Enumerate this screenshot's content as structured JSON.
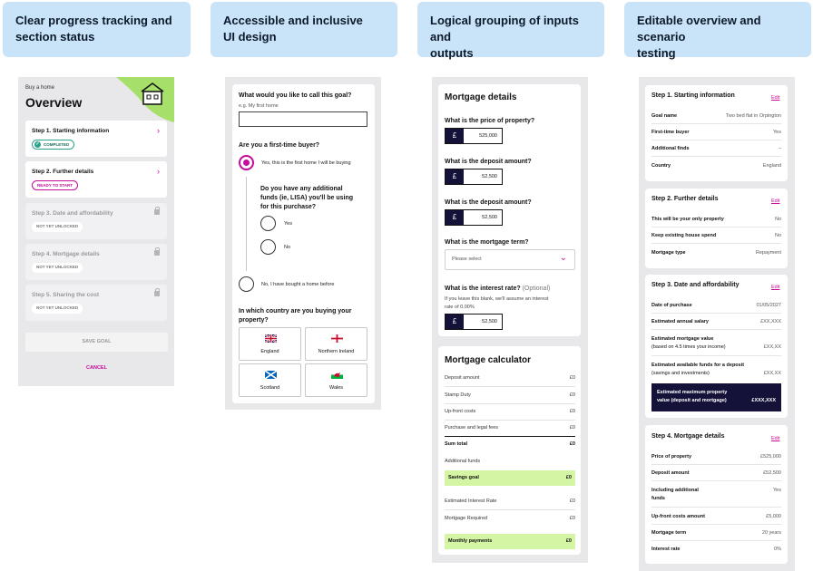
{
  "headers": [
    {
      "line1": "Clear progress tracking and",
      "line2": "section status"
    },
    {
      "line1": "Accessible and inclusive",
      "line2": "UI design"
    },
    {
      "line1": "Logical grouping of inputs and",
      "line2": "outputs"
    },
    {
      "line1": "Editable overview and scenario",
      "line2": "testing"
    }
  ],
  "overview": {
    "eyebrow": "Buy a home",
    "title": "Overview",
    "steps": [
      {
        "title": "Step 1. Starting information",
        "status": "COMPLETED"
      },
      {
        "title": "Step 2. Further details",
        "status": "READY TO START"
      },
      {
        "title": "Step 3. Date and affordability",
        "status": "NOT YET UNLOCKED"
      },
      {
        "title": "Step 4. Mortgage details",
        "status": "NOT YET UNLOCKED"
      },
      {
        "title": "Step 5. Sharing the cost",
        "status": "NOT YET UNLOCKED"
      }
    ],
    "save_label": "SAVE GOAL",
    "cancel_label": "CANCEL",
    "accent": "#c60a9a"
  },
  "form": {
    "goal_question": "What would you like to call this goal?",
    "goal_placeholder": "e.g. My first home",
    "ftb_question": "Are you a first-time buyer?",
    "ftb_yes": "Yes, this is the first home I will be buying",
    "lisa_question_1": "Do you have any additional",
    "lisa_question_2": "funds (ie, LISA) you'll be using",
    "lisa_question_3": "for this purchase?",
    "lisa_yes": "Yes",
    "lisa_no": "No",
    "ftb_no": "No, I have bought a home before",
    "country_question_1": "In which country are you buying your",
    "country_question_2": "property?",
    "countries": [
      "England",
      "Northern Ireland",
      "Scotland",
      "Wales"
    ]
  },
  "mortgage": {
    "title": "Mortgage details",
    "price_q": "What is the price of property?",
    "price_val": "525,000",
    "deposit_q": "What is the deposit amount?",
    "deposit_val": "52,500",
    "deposit_q2": "What is the deposit amount?",
    "deposit_val2": "52,500",
    "term_q": "What is the mortgage term?",
    "term_placeholder": "Please select",
    "rate_q": "What is the interest rate?",
    "rate_optional": "(Optional)",
    "rate_hint_1": "If you leave this blank, we'll assume an interest",
    "rate_hint_2": "rate of 0.00%",
    "rate_val": "52,500",
    "currency": "£"
  },
  "calculator": {
    "title": "Mortgage calculator",
    "rows": [
      {
        "label": "Deposit amount",
        "value": "£0"
      },
      {
        "label": "Stamp Duty",
        "value": "£0"
      },
      {
        "label": "Up-front costs",
        "value": "£0"
      },
      {
        "label": "Purchase and legal fees",
        "value": "£0"
      }
    ],
    "sum_label": "Sum total",
    "sum_value": "£0",
    "additional_label": "Additional funds",
    "savings_label": "Savings goal",
    "savings_value": "£0",
    "eir_label": "Estimated Interest Rate",
    "eir_value": "£0",
    "mreq_label": "Mortgage Required",
    "mreq_value": "£0",
    "monthly_label": "Monthly payments",
    "monthly_value": "£0"
  },
  "summary": {
    "edit_label": "Edit",
    "step1": {
      "title": "Step 1. Starting information",
      "rows": [
        {
          "k": "Goal name",
          "v": "Two bed flat in Orpington"
        },
        {
          "k": "First-time buyer",
          "v": "Yes"
        },
        {
          "k": "Additional finds",
          "v": "–"
        },
        {
          "k": "Country",
          "v": "England"
        }
      ]
    },
    "step2": {
      "title": "Step 2. Further details",
      "rows": [
        {
          "k": "This will be your only property",
          "v": "No"
        },
        {
          "k": "Keep existing house spend",
          "v": "No"
        },
        {
          "k": "Mortgage type",
          "v": "Repayment"
        }
      ]
    },
    "step3": {
      "title": "Step 3. Date and affordability",
      "rows": [
        {
          "k": "Date of purchase",
          "v": "01/05/2027"
        },
        {
          "k": "Estimated annual salary",
          "v": "£XX,XXX"
        },
        {
          "k": "Estimated mortgage value",
          "sub": "(based on 4.5 times your income)",
          "v": "£XX,XX"
        },
        {
          "k": "Estimated available funds for a deposit",
          "sub": "(savings and investments)",
          "v": "£XX,XX"
        }
      ],
      "max_label_1": "Estimated maximum property",
      "max_label_2": "value (deposit and mortgage)",
      "max_value": "£XXX,XXX"
    },
    "step4": {
      "title": "Step 4. Mortgage details",
      "rows": [
        {
          "k": "Price of property",
          "v": "£525,000"
        },
        {
          "k": "Deposit amount",
          "v": "£52,500"
        },
        {
          "k": "Including additional",
          "k2": "funds",
          "v": "Yes"
        },
        {
          "k": "Up-front costs amount",
          "v": "£5,000"
        },
        {
          "k": "Mortgage term",
          "v": "20 years"
        },
        {
          "k": "Interest rate",
          "v": "0%"
        }
      ]
    }
  }
}
